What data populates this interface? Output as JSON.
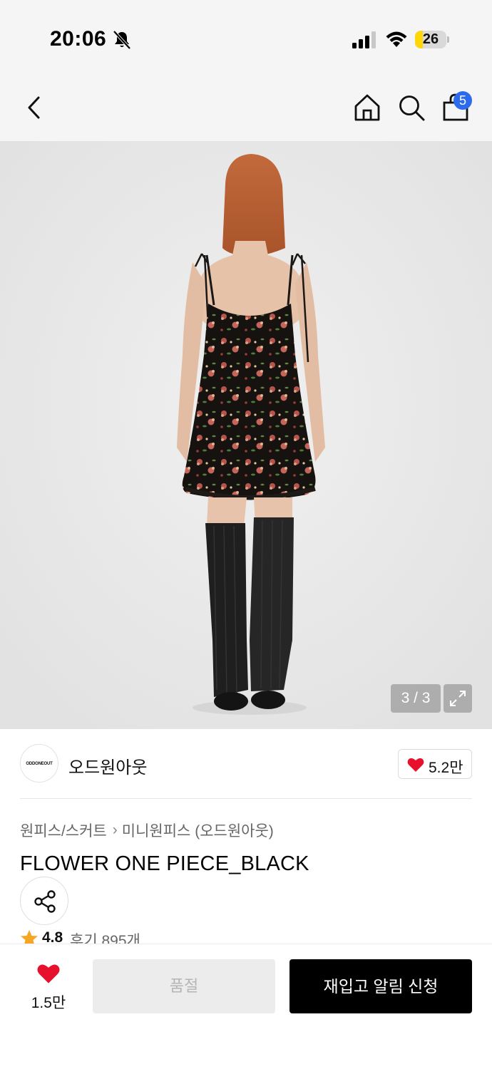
{
  "status_bar": {
    "time": "20:06",
    "battery_level": "26",
    "icons": [
      "bell-slash-icon",
      "cellular-signal-icon",
      "wifi-icon",
      "battery-icon"
    ]
  },
  "nav": {
    "icons": [
      "back-chevron-icon",
      "home-icon",
      "search-icon",
      "shopping-bag-icon"
    ],
    "cart_count": "5"
  },
  "gallery": {
    "counter": "3 / 3",
    "current_image": 3,
    "total_images": 3
  },
  "brand": {
    "logo_text": "ODDONEOUT",
    "name": "오드원아웃",
    "likes": "5.2만"
  },
  "product": {
    "breadcrumb": [
      "원피스/스커트",
      "미니원피스 (오드원아웃)"
    ],
    "title": "FLOWER ONE PIECE_BLACK",
    "rating": "4.8",
    "reviews": "후기 895개"
  },
  "bottom_bar": {
    "wish_count": "1.5만",
    "soldout_label": "품절",
    "restock_label": "재입고 알림 신청"
  },
  "colors": {
    "accent_blue": "#2c6bed",
    "heart_red": "#e8112d",
    "star_orange": "#f5a623",
    "battery_yellow": "#ffd60a"
  }
}
